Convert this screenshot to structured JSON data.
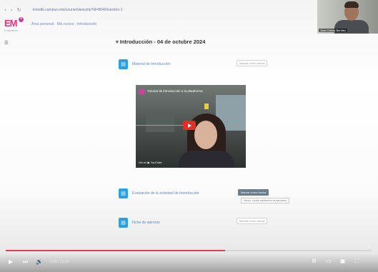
{
  "browser": {
    "nav_back": "‹",
    "nav_forward": "›",
    "nav_reload": "↻",
    "address": "moodle.campus.edu/course/view.php?id=8640#section-1"
  },
  "logo": {
    "text": "EM",
    "sub": "Formación",
    "plus": "+"
  },
  "breadcrumb": "Área personal · Mis cursos · Introducción",
  "sidebar_icon": "menu-icon",
  "webcam": {
    "name": "Juan Carlos Benítez"
  },
  "section": {
    "title": "Introducción - 04 de octubre 2024",
    "chevron": "▾"
  },
  "activities": [
    {
      "icon": "file-icon",
      "glyph": "▤",
      "label": "Material de Introducción",
      "status": "Marcar como hecha"
    },
    {
      "icon": "file-icon",
      "glyph": "▤",
      "label": "Evaluación de la actividad de Introducción",
      "status": ""
    },
    {
      "icon": "file-icon",
      "glyph": "▤",
      "label": "Ficha de ejercicio",
      "status": "Marcar como hecha"
    }
  ],
  "video": {
    "title": "Tutorial de introducción a la plataforma",
    "youtube_label": "Ver en ▶ YouTube"
  },
  "completion": {
    "button": "Marcar como hecha",
    "condition": "Hecho: recibir calificación de aprobado"
  },
  "player": {
    "progress": 0.6,
    "time": "0:00 / 12:34",
    "accent": "#e3434f",
    "play": "▶",
    "next": "⏭",
    "volume": "🔊",
    "icons": [
      "settings-icon",
      "theater-icon",
      "fullscreen-icon"
    ]
  }
}
